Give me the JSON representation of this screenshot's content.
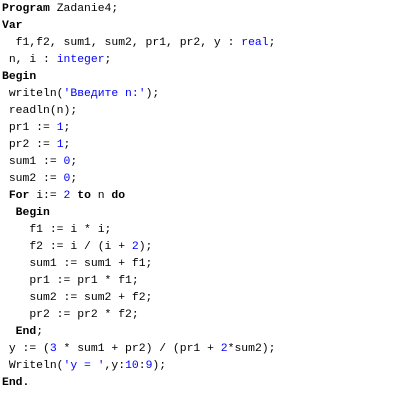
{
  "editor": {
    "colors": {
      "background": "#ffffff",
      "text": "#000000",
      "keyword": "#000000",
      "type": "#0000ff",
      "number": "#0000ff",
      "string": "#0000ff"
    },
    "lines": [
      [
        {
          "k": "kw",
          "t": "Program"
        },
        {
          "k": "plain",
          "t": " Zadanie4;"
        }
      ],
      [
        {
          "k": "kw",
          "t": "Var"
        }
      ],
      [
        {
          "k": "plain",
          "t": "  f1,f2, sum1, sum2, pr1, pr2, y : "
        },
        {
          "k": "ty",
          "t": "real"
        },
        {
          "k": "plain",
          "t": ";"
        }
      ],
      [
        {
          "k": "plain",
          "t": " n, i : "
        },
        {
          "k": "ty",
          "t": "integer"
        },
        {
          "k": "plain",
          "t": ";"
        }
      ],
      [
        {
          "k": "kw",
          "t": "Begin"
        }
      ],
      [
        {
          "k": "plain",
          "t": " writeln("
        },
        {
          "k": "str",
          "t": "'Введите n:'"
        },
        {
          "k": "plain",
          "t": ");"
        }
      ],
      [
        {
          "k": "plain",
          "t": " readln(n);"
        }
      ],
      [
        {
          "k": "plain",
          "t": " pr1 := "
        },
        {
          "k": "num",
          "t": "1"
        },
        {
          "k": "plain",
          "t": ";"
        }
      ],
      [
        {
          "k": "plain",
          "t": " pr2 := "
        },
        {
          "k": "num",
          "t": "1"
        },
        {
          "k": "plain",
          "t": ";"
        }
      ],
      [
        {
          "k": "plain",
          "t": " sum1 := "
        },
        {
          "k": "num",
          "t": "0"
        },
        {
          "k": "plain",
          "t": ";"
        }
      ],
      [
        {
          "k": "plain",
          "t": " sum2 := "
        },
        {
          "k": "num",
          "t": "0"
        },
        {
          "k": "plain",
          "t": ";"
        }
      ],
      [
        {
          "k": "plain",
          "t": " "
        },
        {
          "k": "kw",
          "t": "For"
        },
        {
          "k": "plain",
          "t": " i:= "
        },
        {
          "k": "num",
          "t": "2"
        },
        {
          "k": "plain",
          "t": " "
        },
        {
          "k": "kw",
          "t": "to"
        },
        {
          "k": "plain",
          "t": " n "
        },
        {
          "k": "kw",
          "t": "do"
        }
      ],
      [
        {
          "k": "plain",
          "t": "  "
        },
        {
          "k": "kw",
          "t": "Begin"
        }
      ],
      [
        {
          "k": "plain",
          "t": "    f1 := i * i;"
        }
      ],
      [
        {
          "k": "plain",
          "t": "    f2 := i / (i + "
        },
        {
          "k": "num",
          "t": "2"
        },
        {
          "k": "plain",
          "t": ");"
        }
      ],
      [
        {
          "k": "plain",
          "t": "    sum1 := sum1 + f1;"
        }
      ],
      [
        {
          "k": "plain",
          "t": "    pr1 := pr1 * f1;"
        }
      ],
      [
        {
          "k": "plain",
          "t": "    sum2 := sum2 + f2;"
        }
      ],
      [
        {
          "k": "plain",
          "t": "    pr2 := pr2 * f2;"
        }
      ],
      [
        {
          "k": "plain",
          "t": "  "
        },
        {
          "k": "kw",
          "t": "End"
        },
        {
          "k": "plain",
          "t": ";"
        }
      ],
      [
        {
          "k": "plain",
          "t": " y := ("
        },
        {
          "k": "num",
          "t": "3"
        },
        {
          "k": "plain",
          "t": " * sum1 + pr2) / (pr1 + "
        },
        {
          "k": "num",
          "t": "2"
        },
        {
          "k": "plain",
          "t": "*sum2);"
        }
      ],
      [
        {
          "k": "plain",
          "t": " Writeln("
        },
        {
          "k": "str",
          "t": "'y = '"
        },
        {
          "k": "plain",
          "t": ",y:"
        },
        {
          "k": "num",
          "t": "10"
        },
        {
          "k": "plain",
          "t": ":"
        },
        {
          "k": "num",
          "t": "9"
        },
        {
          "k": "plain",
          "t": ");"
        }
      ],
      [
        {
          "k": "kw",
          "t": "End."
        }
      ]
    ]
  }
}
